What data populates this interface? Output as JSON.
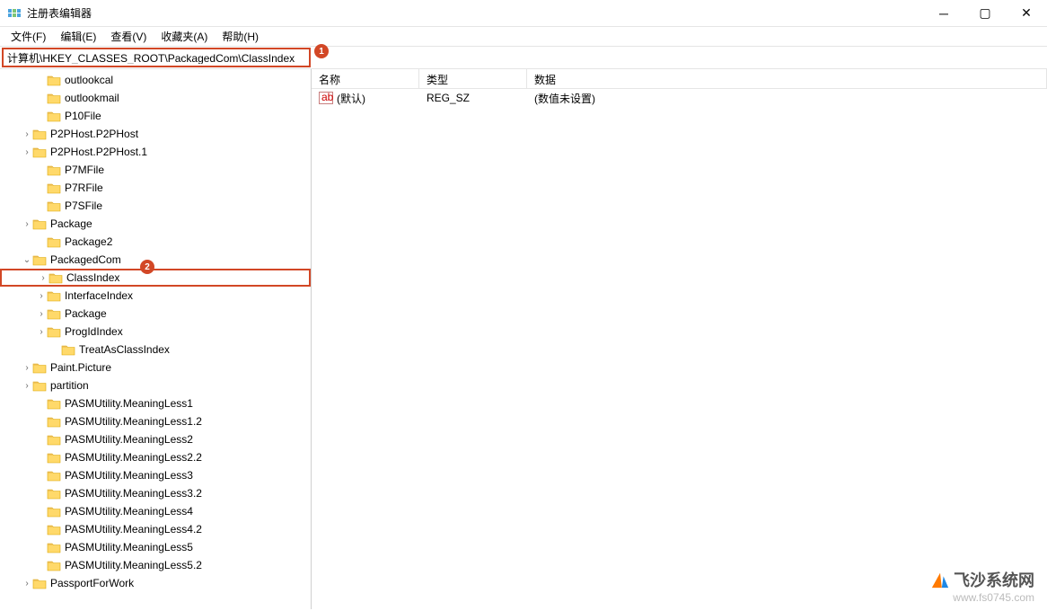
{
  "window": {
    "title": "注册表编辑器"
  },
  "menu": {
    "file": "文件(F)",
    "edit": "编辑(E)",
    "view": "查看(V)",
    "favorites": "收藏夹(A)",
    "help": "帮助(H)"
  },
  "address": {
    "path": "计算机\\HKEY_CLASSES_ROOT\\PackagedCom\\ClassIndex"
  },
  "callouts": {
    "c1": "1",
    "c2": "2"
  },
  "tree": [
    {
      "indent": 2,
      "expander": "",
      "label": "outlookcal"
    },
    {
      "indent": 2,
      "expander": "",
      "label": "outlookmail"
    },
    {
      "indent": 2,
      "expander": "",
      "label": "P10File"
    },
    {
      "indent": 1,
      "expander": "›",
      "label": "P2PHost.P2PHost"
    },
    {
      "indent": 1,
      "expander": "›",
      "label": "P2PHost.P2PHost.1"
    },
    {
      "indent": 2,
      "expander": "",
      "label": "P7MFile"
    },
    {
      "indent": 2,
      "expander": "",
      "label": "P7RFile"
    },
    {
      "indent": 2,
      "expander": "",
      "label": "P7SFile"
    },
    {
      "indent": 1,
      "expander": "›",
      "label": "Package"
    },
    {
      "indent": 2,
      "expander": "",
      "label": "Package2"
    },
    {
      "indent": 1,
      "expander": "⌄",
      "label": "PackagedCom"
    },
    {
      "indent": 2,
      "expander": "›",
      "label": "ClassIndex",
      "selected": true
    },
    {
      "indent": 2,
      "expander": "›",
      "label": "InterfaceIndex"
    },
    {
      "indent": 2,
      "expander": "›",
      "label": "Package"
    },
    {
      "indent": 2,
      "expander": "›",
      "label": "ProgIdIndex"
    },
    {
      "indent": 3,
      "expander": "",
      "label": "TreatAsClassIndex"
    },
    {
      "indent": 1,
      "expander": "›",
      "label": "Paint.Picture"
    },
    {
      "indent": 1,
      "expander": "›",
      "label": "partition"
    },
    {
      "indent": 2,
      "expander": "",
      "label": "PASMUtility.MeaningLess1"
    },
    {
      "indent": 2,
      "expander": "",
      "label": "PASMUtility.MeaningLess1.2"
    },
    {
      "indent": 2,
      "expander": "",
      "label": "PASMUtility.MeaningLess2"
    },
    {
      "indent": 2,
      "expander": "",
      "label": "PASMUtility.MeaningLess2.2"
    },
    {
      "indent": 2,
      "expander": "",
      "label": "PASMUtility.MeaningLess3"
    },
    {
      "indent": 2,
      "expander": "",
      "label": "PASMUtility.MeaningLess3.2"
    },
    {
      "indent": 2,
      "expander": "",
      "label": "PASMUtility.MeaningLess4"
    },
    {
      "indent": 2,
      "expander": "",
      "label": "PASMUtility.MeaningLess4.2"
    },
    {
      "indent": 2,
      "expander": "",
      "label": "PASMUtility.MeaningLess5"
    },
    {
      "indent": 2,
      "expander": "",
      "label": "PASMUtility.MeaningLess5.2"
    },
    {
      "indent": 1,
      "expander": "›",
      "label": "PassportForWork"
    }
  ],
  "values": {
    "headers": {
      "name": "名称",
      "type": "类型",
      "data": "数据"
    },
    "rows": [
      {
        "name": "(默认)",
        "type": "REG_SZ",
        "data": "(数值未设置)"
      }
    ]
  },
  "watermark": {
    "line1": "飞沙系统网",
    "line2": "www.fs0745.com"
  }
}
